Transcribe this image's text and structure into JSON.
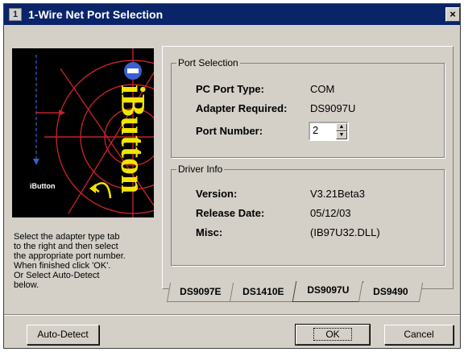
{
  "window": {
    "title": "1-Wire Net Port Selection",
    "close_label": "×"
  },
  "logo": {
    "brand": "iButton",
    "small_brand": "iButton"
  },
  "side_text": [
    "Select the adapter type tab",
    "to the right and then select",
    "the appropriate port number.",
    "When finished click 'OK'.",
    "Or Select Auto-Detect",
    "below."
  ],
  "port_selection": {
    "title": "Port Selection",
    "pc_port_type_label": "PC Port Type:",
    "pc_port_type_value": "COM",
    "adapter_label": "Adapter Required:",
    "adapter_value": "DS9097U",
    "port_number_label": "Port Number:",
    "port_number_value": "2"
  },
  "driver_info": {
    "title": "Driver Info",
    "version_label": "Version:",
    "version_value": "V3.21Beta3",
    "release_label": "Release Date:",
    "release_value": "05/12/03",
    "misc_label": "Misc:",
    "misc_value": "(IB97U32.DLL)"
  },
  "tabs": [
    "DS9097E",
    "DS1410E",
    "DS9097U",
    "DS9490"
  ],
  "active_tab": "DS9097U",
  "buttons": {
    "auto_detect": "Auto-Detect",
    "ok": "OK",
    "cancel": "Cancel"
  }
}
